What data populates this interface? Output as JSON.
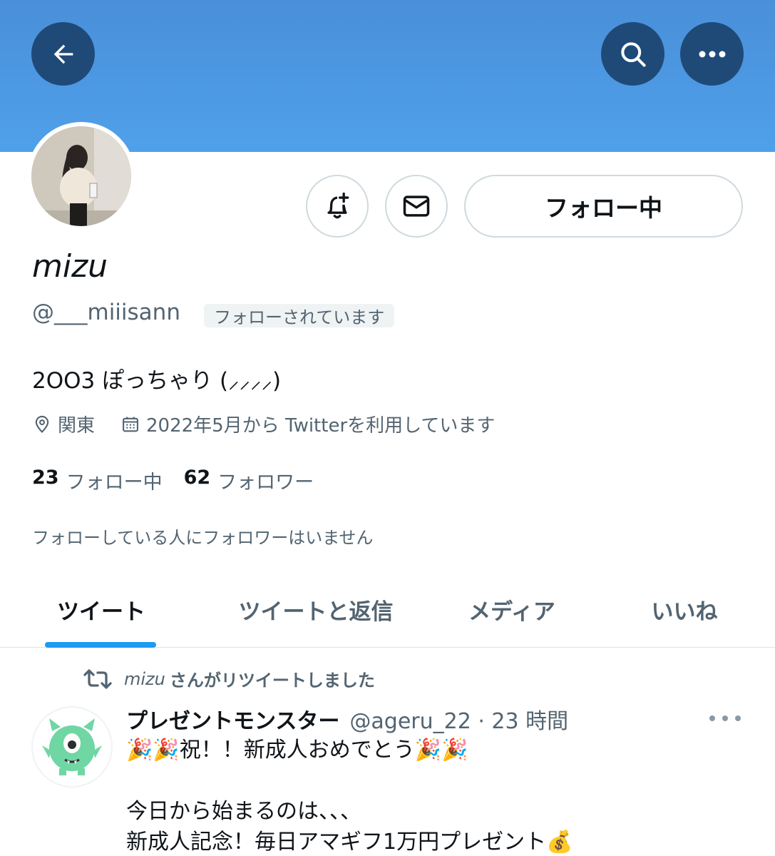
{
  "header": {
    "back_icon": "arrow-left-icon",
    "search_icon": "search-icon",
    "more_icon": "more-horizontal-icon",
    "banner_color": "#4a96e3"
  },
  "profile": {
    "display_name": "mizu",
    "handle": "@___miiisann",
    "follows_you_badge": "フォローされています",
    "bio": "2OO3 ぽっちゃり (⸝⸝⸝⸝)",
    "location": "関東",
    "joined": "2022年5月から Twitterを利用しています",
    "following_count": "23",
    "following_label": "フォロー中",
    "followers_count": "62",
    "followers_label": "フォロワー",
    "mutual_note": "フォローしている人にフォロワーはいません"
  },
  "actions": {
    "notify_icon": "bell-plus-icon",
    "message_icon": "mail-icon",
    "following_button_label": "フォロー中"
  },
  "tabs": [
    {
      "label": "ツイート",
      "active": true
    },
    {
      "label": "ツイートと返信",
      "active": false
    },
    {
      "label": "メディア",
      "active": false
    },
    {
      "label": "いいね",
      "active": false
    }
  ],
  "tweet": {
    "retweet_icon": "retweet-icon",
    "retweeter_name": "mizu",
    "retweet_text": "さんがリツイートしました",
    "author_name": "プレゼントモンスター",
    "author_meta": "@ageru_22 · 23 時間",
    "line1_text": "祝！！新成人おめでとう",
    "line2_text": "",
    "line3_text": "今日から始まるのは、、、",
    "line4_text": "新成人記念！毎日アマギフ1万円プレゼント",
    "emoji_party": "🎉",
    "emoji_money": "💰",
    "more_icon": "more-horizontal-icon",
    "avatar_color": "#6fd6a4"
  }
}
